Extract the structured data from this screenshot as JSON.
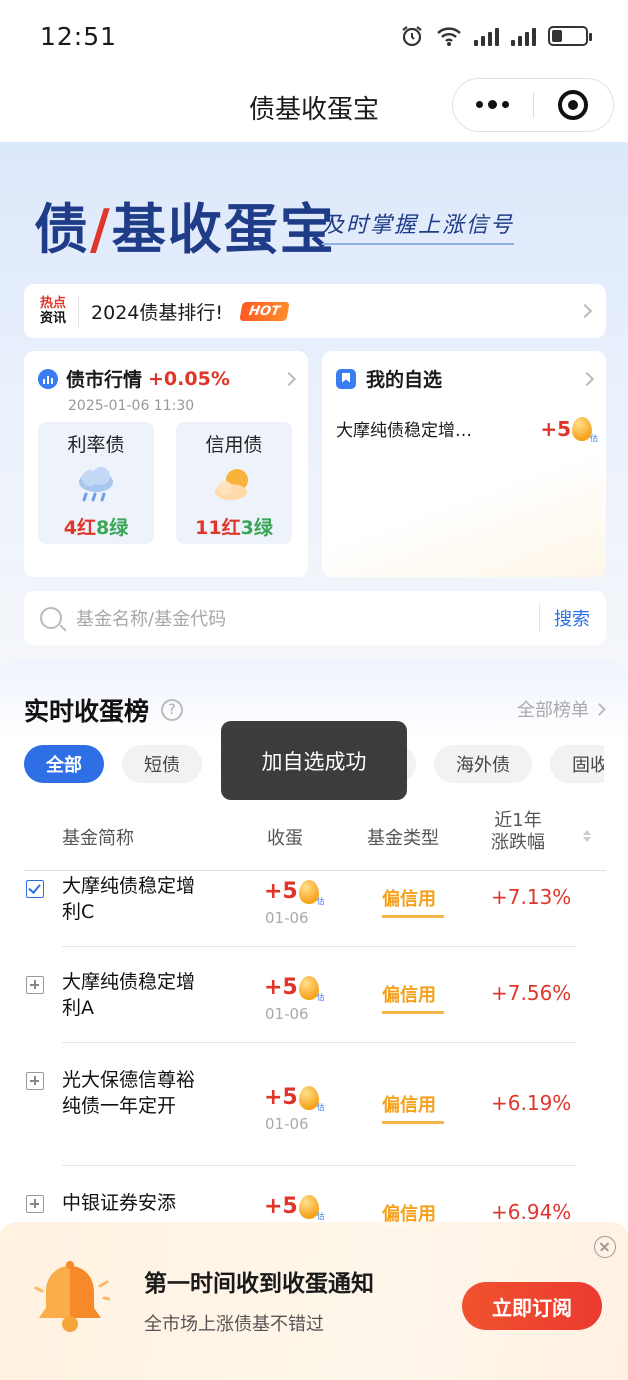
{
  "status": {
    "time": "12:51"
  },
  "nav": {
    "title": "债基收蛋宝"
  },
  "hero": {
    "brand_a": "债",
    "brand_b": "基收蛋宝",
    "slogan": "及时掌握上涨信号"
  },
  "hot": {
    "label_top": "热点",
    "label_bottom": "资讯",
    "text": "2024债基排行!",
    "badge": "HOT"
  },
  "market": {
    "name": "债市行情",
    "change": "+0.05%",
    "date": "2025-01-06 11:30",
    "tiles": [
      {
        "name": "利率债",
        "weather": "rain-cloud-icon",
        "red": "4红",
        "green": "8绿"
      },
      {
        "name": "信用债",
        "weather": "sun-cloud-icon",
        "red": "11红",
        "green": "3绿"
      }
    ]
  },
  "watch": {
    "name": "我的自选",
    "item_name": "大摩纯债稳定增…",
    "item_value": "+5"
  },
  "search": {
    "placeholder": "基金名称/基金代码",
    "button": "搜索"
  },
  "ranking": {
    "title": "实时收蛋榜",
    "more": "全部榜单",
    "tabs": [
      "全部",
      "短债",
      "",
      "",
      "海外债",
      "固收+"
    ],
    "headers": {
      "name": "基金简称",
      "egg": "收蛋",
      "type": "基金类型",
      "change_l1": "近1年",
      "change_l2": "涨跌幅"
    },
    "rows": [
      {
        "name": "大摩纯债稳定增利C",
        "egg": "+5",
        "date": "01-06",
        "type": "偏信用",
        "change": "+7.13%",
        "selected": true
      },
      {
        "name": "大摩纯债稳定增利A",
        "egg": "+5",
        "date": "01-06",
        "type": "偏信用",
        "change": "+7.56%",
        "selected": false
      },
      {
        "name": "光大保德信尊裕纯债一年定开",
        "egg": "+5",
        "date": "01-06",
        "type": "偏信用",
        "change": "+6.19%",
        "selected": false
      },
      {
        "name": "中银证券安添",
        "egg": "+5",
        "date": "",
        "type": "偏信用",
        "change": "+6.94%",
        "selected": false
      }
    ]
  },
  "toast": {
    "text": "加自选成功"
  },
  "banner": {
    "title": "第一时间收到收蛋通知",
    "subtitle": "全市场上涨债基不错过",
    "button": "立即订阅"
  },
  "colors": {
    "accent_blue": "#2f6fe6",
    "up_red": "#e0352b",
    "down_green": "#3aa657",
    "credit_orange": "#f5a11c"
  }
}
